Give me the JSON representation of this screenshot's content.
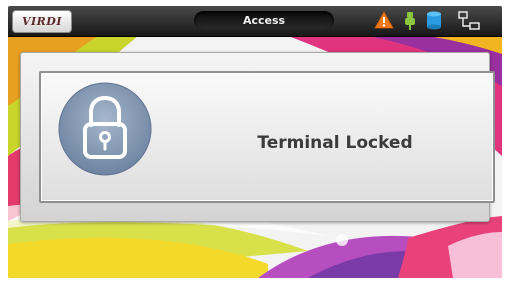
{
  "header": {
    "logo_text": "VIRDI",
    "title": "Access"
  },
  "status_icons": [
    {
      "name": "warning-icon",
      "color": "#f07a16"
    },
    {
      "name": "usb-icon",
      "color": "#8cc63e"
    },
    {
      "name": "database-icon",
      "color": "#2a9be0"
    },
    {
      "name": "network-icon",
      "color": "#f2f2f2"
    }
  ],
  "main": {
    "message": "Terminal Locked",
    "icon": "lock-icon"
  },
  "colors": {
    "topbar": "#1f1f1f",
    "lock_circle": "#7f93ad",
    "message_text": "#3b3b3b"
  }
}
